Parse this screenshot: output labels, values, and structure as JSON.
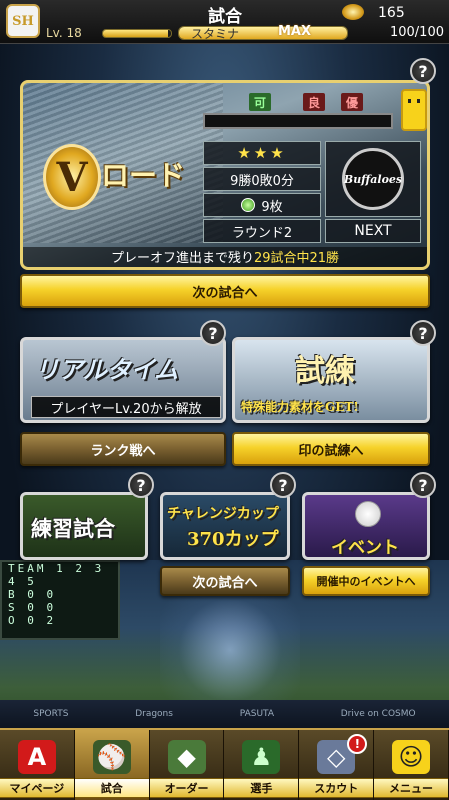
{
  "header": {
    "team_logo_text": "SH",
    "title": "試合",
    "coins": "165",
    "level": "Lv. 18",
    "stamina_label": "スタミナ",
    "stamina_max": "MAX",
    "stamina_value": "100/100",
    "exp_fraction": 0.95,
    "stamina_fraction": 1.0
  },
  "vroad": {
    "title": "ロード",
    "v_letter": "V",
    "eval_tags": [
      "可",
      "良",
      "優"
    ],
    "stars": "★★★",
    "record": "9勝0敗0分",
    "medals": "9枚",
    "round": "ラウンド2",
    "opponent_logo_text": "Buffaloes",
    "next_label": "NEXT",
    "playoff_prefix": "プレーオフ進出まで残り",
    "playoff_highlight": "29試合中21勝"
  },
  "buttons": {
    "next_game": "次の試合へ",
    "rank_match": "ランク戦へ",
    "shirushi_trial": "印の試練へ",
    "challenge_next_game": "次の試合へ",
    "open_event": "開催中のイベントへ"
  },
  "cards": {
    "realtime_title": "リアルタイム",
    "realtime_lock": "プレイヤーLv.20から解放",
    "trial_title": "試練",
    "trial_sub": "特殊能力素材をGET!",
    "practice_title": "練習試合",
    "challenge_title": "チャレンジカップ",
    "challenge_sub": "370カップ",
    "event_title": "イベント"
  },
  "scoreboard": {
    "row1": "TEAM 1 2 3 4 5",
    "row2": "B  0 0",
    "row3": "S  0 0",
    "row4": "O  0 2"
  },
  "ads": [
    "SPORTS",
    "Dragons",
    "PASUTA",
    "Drive on COSMO"
  ],
  "nav": {
    "items": [
      {
        "label": "マイページ",
        "icon": "A"
      },
      {
        "label": "試合",
        "icon": "⚾"
      },
      {
        "label": "オーダー",
        "icon": "◆"
      },
      {
        "label": "選手",
        "icon": "♟"
      },
      {
        "label": "スカウト",
        "icon": "◇"
      },
      {
        "label": "メニュー",
        "icon": "☺"
      }
    ],
    "scout_badge": "!"
  },
  "colors": {
    "gold": "#f6d22a",
    "accent_yellow": "#ffe34a",
    "badge_red": "#d21a1a"
  }
}
